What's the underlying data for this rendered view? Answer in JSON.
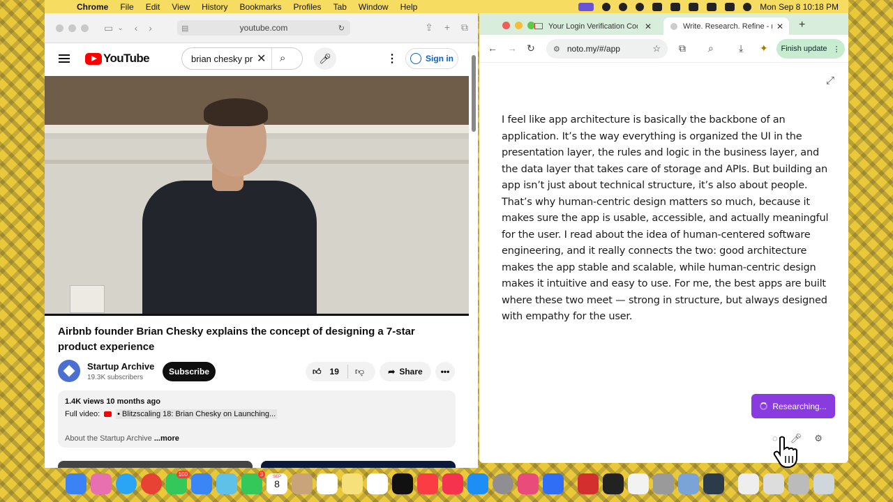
{
  "menubar": {
    "app": "Chrome",
    "items": [
      "File",
      "Edit",
      "View",
      "History",
      "Bookmarks",
      "Profiles",
      "Tab",
      "Window",
      "Help"
    ],
    "datetime": "Mon Sep 8  10:18 PM"
  },
  "safari": {
    "url": "youtube.com",
    "youtube": {
      "logo": "YouTube",
      "search_value": "brian chesky pr",
      "sign_in": "Sign in",
      "video_title": "Airbnb founder Brian Chesky explains the concept of designing a 7-star product experience",
      "channel_name": "Startup Archive",
      "subscribers": "19.3K subscribers",
      "subscribe": "Subscribe",
      "likes": "19",
      "share": "Share",
      "desc_meta": "1.4K views  10 months ago",
      "desc_full_video_label": "Full video:",
      "desc_link": "• Blitzscaling 18: Brian Chesky on Launching...",
      "desc_about": "About the Startup Archive",
      "desc_more": "...more"
    }
  },
  "chrome": {
    "tabs": [
      {
        "title": "Your Login Verification Code"
      },
      {
        "title": "Write. Research. Refine - noto"
      }
    ],
    "url": "noto.my/#/app",
    "finish_update": "Finish update",
    "essay": "I feel like app architecture is basically the backbone of an application. It’s the way everything is organized the UI in the presentation layer, the rules and logic in the business layer, and the data layer that takes care of storage and APIs. But building an app isn’t just about technical structure, it’s also about people. That’s why human-centric design matters so much, because it makes sure the app is usable, accessible, and actually meaningful for the user. I read about the idea of human-centered software engineering, and it really connects the two: good architecture makes the app stable and scalable, while human-centric design makes it intuitive and easy to use. For me, the best apps are built where these two meet — strong in structure, but always designed with empathy for the user.",
    "researching": "Researching..."
  },
  "dock": {
    "badges": {
      "mail": "100",
      "facetime": "3"
    },
    "calendar": {
      "month": "SEP",
      "day": "8"
    }
  },
  "colors": {
    "research_button": "#8a3be0",
    "finish_update_bg": "#c8ecd0",
    "youtube_red": "#ff0000",
    "sign_in_blue": "#065fd4"
  }
}
